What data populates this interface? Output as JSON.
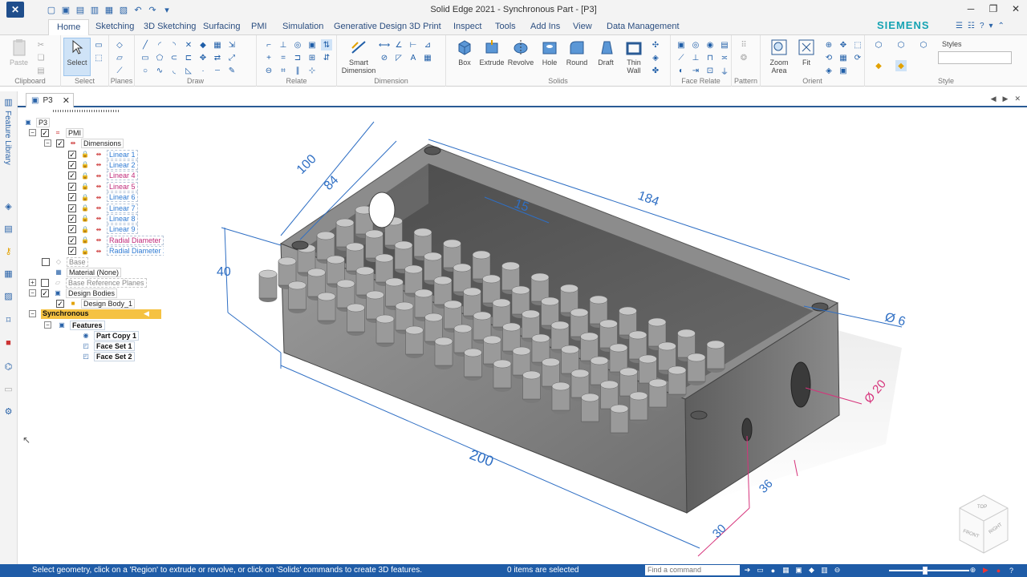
{
  "window": {
    "title": "Solid Edge 2021 - Synchronous Part - [P3]",
    "logo_icon": "solid-edge-logo-icon",
    "brand": "SIEMENS"
  },
  "ribbon_tabs": [
    "Home",
    "Sketching",
    "3D Sketching",
    "Surfacing",
    "PMI",
    "Simulation",
    "Generative Design",
    "3D Print",
    "Inspect",
    "Tools",
    "Add Ins",
    "View",
    "Data Management"
  ],
  "active_tab": "Home",
  "ribbon": {
    "clipboard": {
      "label": "Clipboard",
      "paste": "Paste"
    },
    "select": {
      "label": "Select",
      "select_button": "Select"
    },
    "planes": {
      "label": "Planes"
    },
    "draw": {
      "label": "Draw"
    },
    "relate": {
      "label": "Relate"
    },
    "dimension": {
      "label": "Dimension",
      "smart_dimension": "Smart Dimension"
    },
    "solids": {
      "label": "Solids",
      "box": "Box",
      "extrude": "Extrude",
      "revolve": "Revolve",
      "hole": "Hole",
      "round": "Round",
      "draft": "Draft",
      "thin_wall": "Thin Wall"
    },
    "face_relate": {
      "label": "Face Relate"
    },
    "pattern": {
      "label": "Pattern"
    },
    "orient": {
      "label": "Orient",
      "zoom_area": "Zoom Area",
      "fit": "Fit"
    },
    "style": {
      "label": "Style",
      "styles": "Styles"
    }
  },
  "doc_tab": {
    "name": "P3"
  },
  "feature_library_label": "Feature Library",
  "tree": {
    "root": "P3",
    "pmi": "PMI",
    "dimensions": "Dimensions",
    "dims": [
      {
        "label": "Linear 1",
        "color": "#2f7bd4"
      },
      {
        "label": "Linear 2",
        "color": "#2f7bd4"
      },
      {
        "label": "Linear 4",
        "color": "#c02a7a"
      },
      {
        "label": "Linear 5",
        "color": "#c02a7a"
      },
      {
        "label": "Linear 6",
        "color": "#2f7bd4"
      },
      {
        "label": "Linear 7",
        "color": "#2f7bd4"
      },
      {
        "label": "Linear 8",
        "color": "#2f7bd4"
      },
      {
        "label": "Linear 9",
        "color": "#2f7bd4"
      },
      {
        "label": "Radial Diameter",
        "color": "#c02a7a"
      },
      {
        "label": "Radial Diameter 2",
        "color": "#2f7bd4"
      }
    ],
    "base": "Base",
    "material": "Material (None)",
    "base_ref_planes": "Base Reference Planes",
    "design_bodies": "Design Bodies",
    "design_body_1": "Design Body_1",
    "synchronous": "Synchronous",
    "features": "Features",
    "part_copy": "Part Copy 1",
    "face_set_1": "Face Set 1",
    "face_set_2": "Face Set 2"
  },
  "model_dims": {
    "d100": "100",
    "d84": "84",
    "d184": "184",
    "d15": "15",
    "d40": "40",
    "d6": "Ø 6",
    "d20": "Ø 20",
    "d200": "200",
    "d36": "36",
    "d30": "30"
  },
  "view_cube": {
    "top": "TOP",
    "front": "FRONT",
    "right": "RIGHT"
  },
  "status": {
    "prompt": "Select geometry, click on a 'Region' to extrude or revolve, or click on 'Solids' commands to create 3D features.",
    "selection_count": "0 items are selected",
    "find_placeholder": "Find a command"
  }
}
